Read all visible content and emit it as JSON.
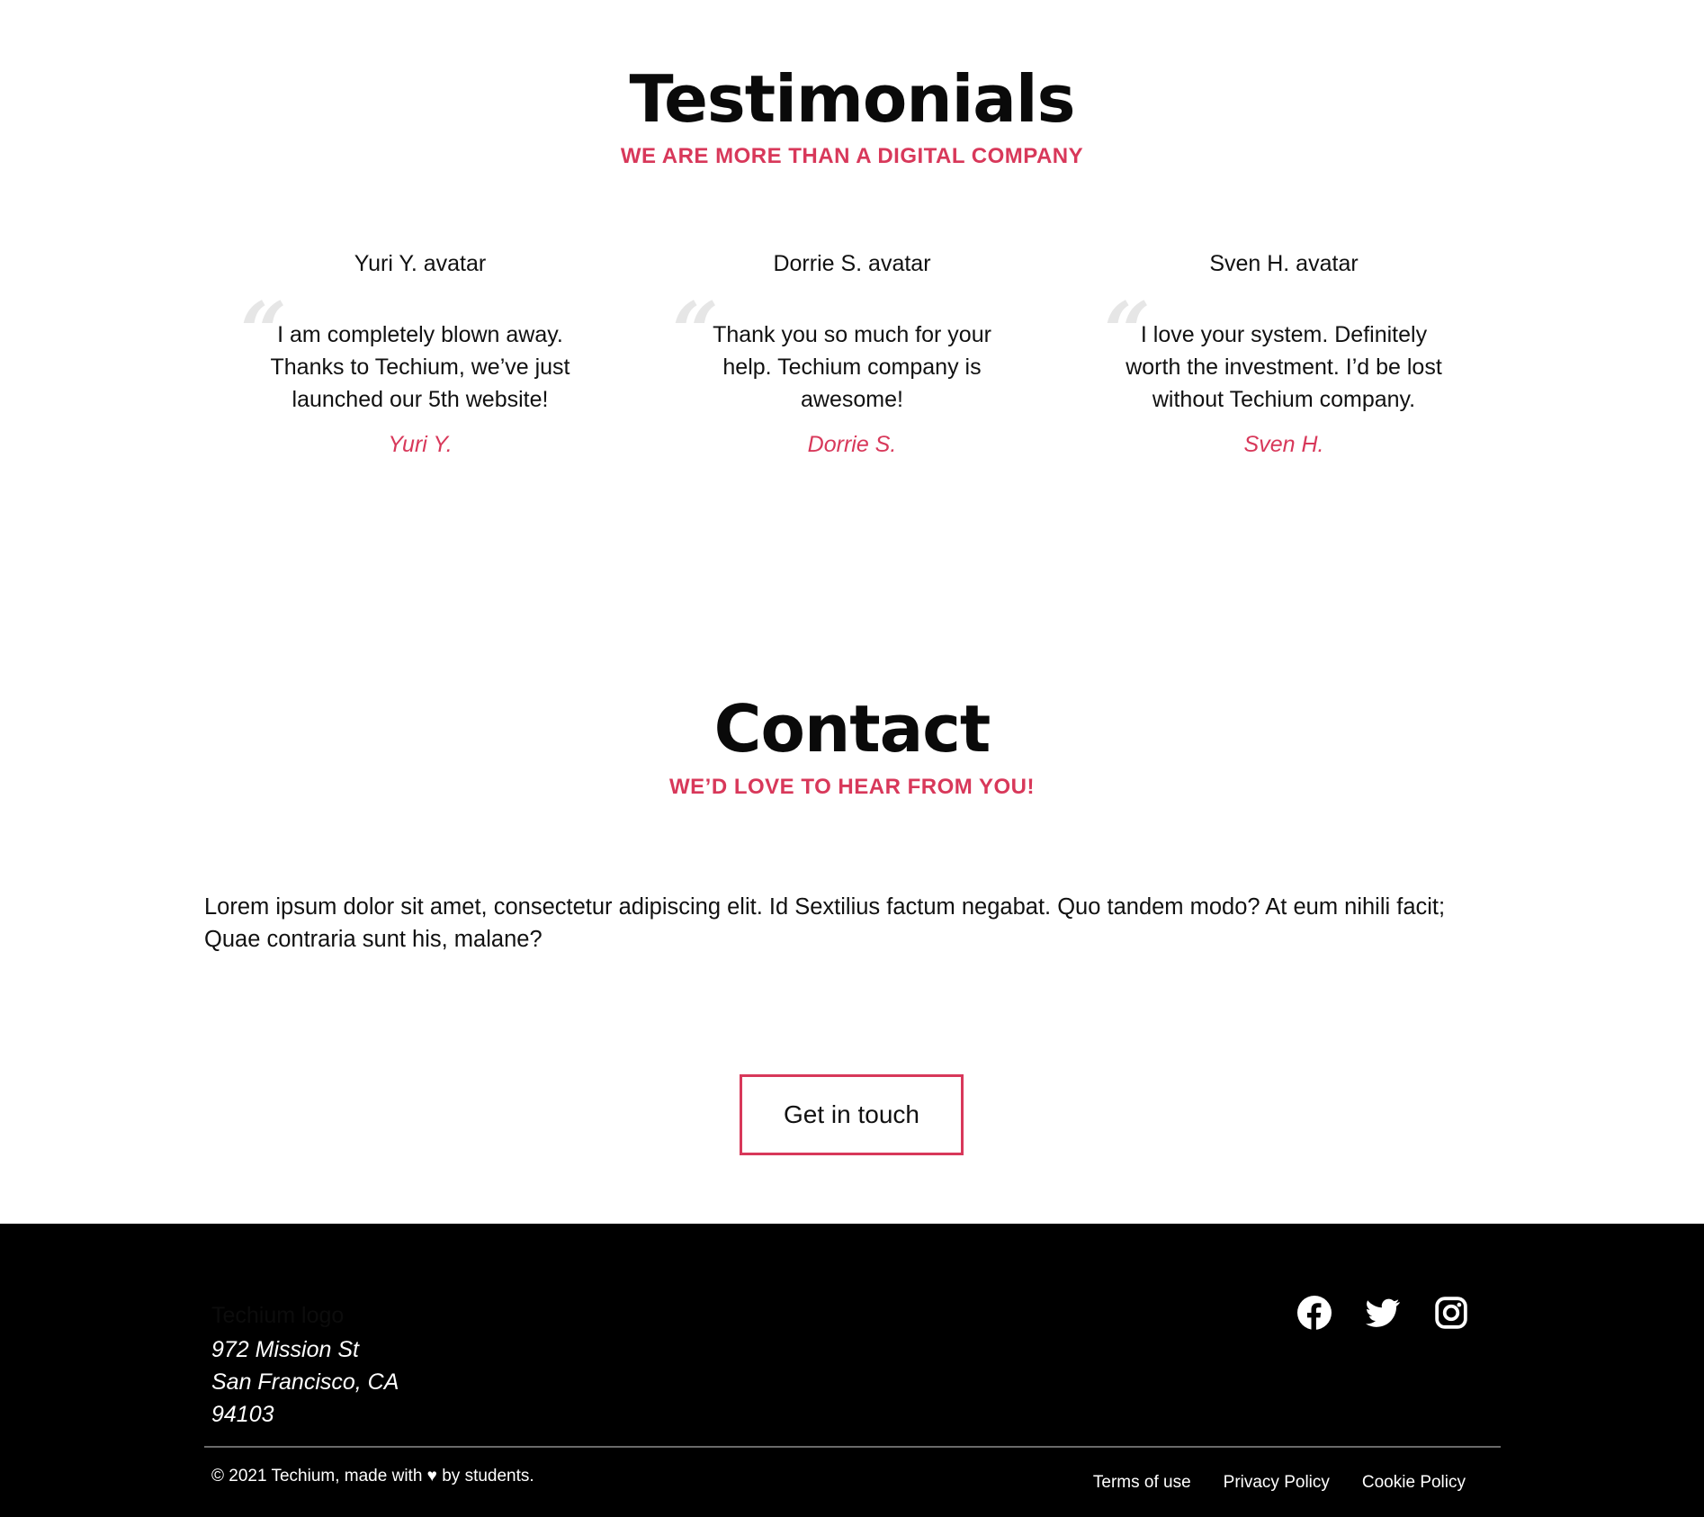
{
  "testimonials": {
    "title": "Testimonials",
    "subtitle": "WE ARE MORE THAN A DIGITAL COMPANY",
    "items": [
      {
        "avatar_alt": "Yuri Y. avatar",
        "quote": "I am completely blown away. Thanks to Techium, we’ve just launched our 5th website!",
        "author": "Yuri Y."
      },
      {
        "avatar_alt": "Dorrie S. avatar",
        "quote": "Thank you so much for your help. Techium company is awesome!",
        "author": "Dorrie S."
      },
      {
        "avatar_alt": "Sven H. avatar",
        "quote": "I love your system. Definitely worth the investment. I’d be lost without Techium company.",
        "author": "Sven H."
      }
    ],
    "quote_mark": "“"
  },
  "contact": {
    "title": "Contact",
    "subtitle": "WE’D LOVE TO HEAR FROM YOU!",
    "text": "Lorem ipsum dolor sit amet, consectetur adipiscing elit. Id Sextilius factum negabat. Quo tandem modo? At eum nihili facit; Quae contraria sunt his, malane?",
    "button_label": "Get in touch"
  },
  "footer": {
    "logo_alt": "Techium logo",
    "address": {
      "line1": "972 Mission St",
      "line2": "San Francisco, CA",
      "line3": "94103"
    },
    "socials": [
      "facebook-icon",
      "twitter-icon",
      "instagram-icon"
    ],
    "copyright": "© 2021 Techium, made with ♥ by students.",
    "links": {
      "terms": "Terms of use",
      "privacy": "Privacy Policy",
      "cookie": "Cookie Policy"
    }
  },
  "colors": {
    "accent": "#d8385a",
    "footer_bg": "#000000",
    "text": "#111111"
  }
}
